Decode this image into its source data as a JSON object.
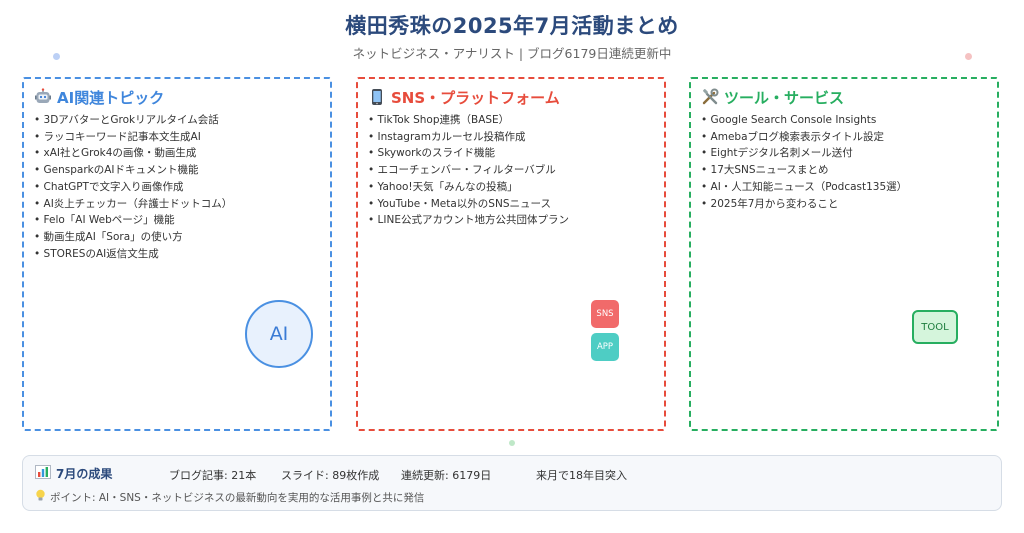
{
  "header": {
    "title": "横田秀珠の2025年7月活動まとめ",
    "subtitle": "ネットビジネス・アナリスト | ブログ6179日連続更新中"
  },
  "cards": [
    {
      "heading": "AI関連トピック",
      "icon": "robot-icon",
      "color": "#4a90e2",
      "badge": "AI",
      "items": [
        "3DアバターとGrokリアルタイム会話",
        "ラッコキーワード記事本文生成AI",
        "xAI社とGrok4の画像・動画生成",
        "GensparkのAIドキュメント機能",
        "ChatGPTで文字入り画像作成",
        "AI炎上チェッカー（弁護士ドットコム）",
        "Felo「AI Webページ」機能",
        "動画生成AI「Sora」の使い方",
        "STORESのAI返信文生成"
      ]
    },
    {
      "heading": "SNS・プラットフォーム",
      "icon": "smartphone-icon",
      "color": "#e74c3c",
      "badges": [
        "SNS",
        "APP"
      ],
      "items": [
        "TikTok Shop連携（BASE）",
        "Instagramカルーセル投稿作成",
        "Skyworkのスライド機能",
        "エコーチェンバー・フィルターバブル",
        "Yahoo!天気「みんなの投稿」",
        "YouTube・Meta以外のSNSニュース",
        "LINE公式アカウント地方公共団体プラン"
      ]
    },
    {
      "heading": "ツール・サービス",
      "icon": "tools-icon",
      "color": "#27ae60",
      "badge": "TOOL",
      "items": [
        "Google Search Console Insights",
        "Amebaブログ検索表示タイトル設定",
        "Eightデジタル名刺メール送付",
        "17大SNSニュースまとめ",
        "AI・人工知能ニュース（Podcast135選）",
        "2025年7月から変わること"
      ]
    }
  ],
  "summary": {
    "heading": "7月の成果",
    "icon": "bar-chart-icon",
    "stats": [
      "ブログ記事: 21本",
      "スライド: 89枚作成",
      "連続更新: 6179日",
      "来月で18年目突入"
    ],
    "note_icon": "lightbulb-icon",
    "note": "ポイント: AI・SNS・ネットビジネスの最新動向を実用的な活用事例と共に発信"
  }
}
